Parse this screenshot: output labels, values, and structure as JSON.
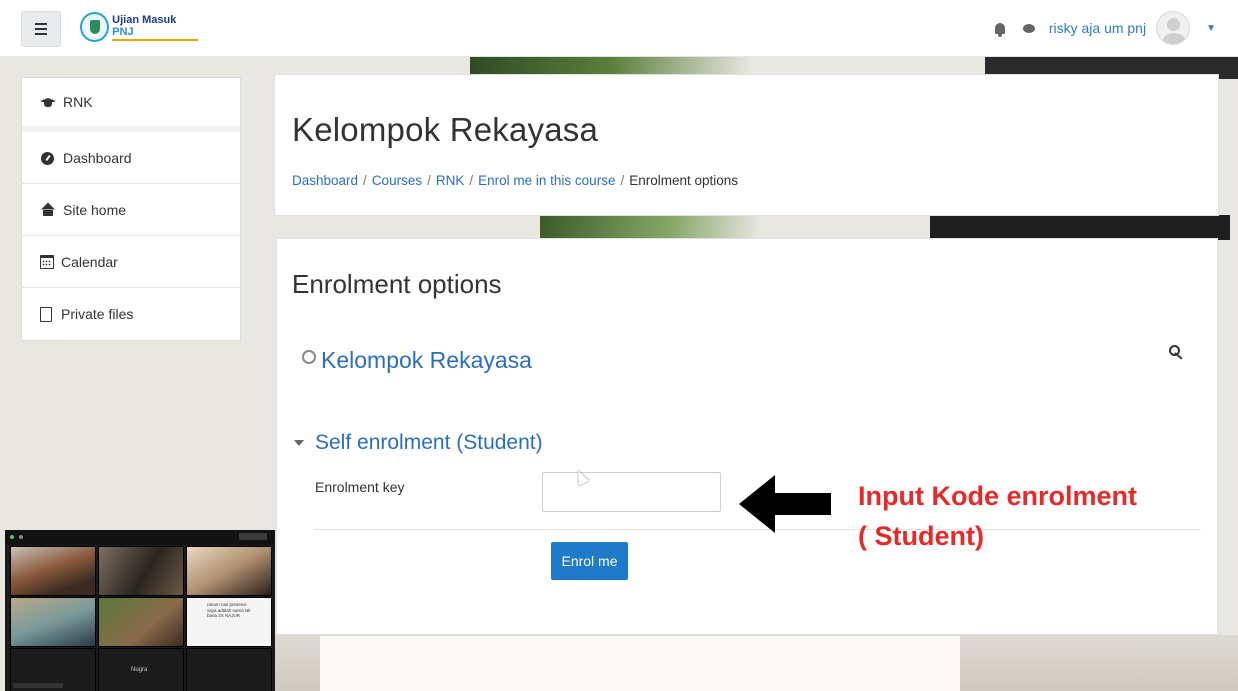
{
  "header": {
    "logo_text_main": "Ujian Masuk",
    "logo_text_brand": "PNJ",
    "username": "risky aja um pnj"
  },
  "sidebar": {
    "items": [
      {
        "label": "RNK",
        "icon": "graduation-cap-icon"
      },
      {
        "label": "Dashboard",
        "icon": "dashboard-icon"
      },
      {
        "label": "Site home",
        "icon": "home-icon"
      },
      {
        "label": "Calendar",
        "icon": "calendar-icon"
      },
      {
        "label": "Private files",
        "icon": "file-icon"
      }
    ]
  },
  "page": {
    "title": "Kelompok Rekayasa",
    "breadcrumb": [
      "Dashboard",
      "Courses",
      "RNK",
      "Enrol me in this course",
      "Enrolment options"
    ]
  },
  "main": {
    "section_title": "Enrolment options",
    "course_name": "Kelompok Rekayasa",
    "enrol_heading": "Self enrolment (Student)",
    "key_label": "Enrolment key",
    "key_value": "",
    "enrol_button": "Enrol me"
  },
  "annotation": {
    "text": "Input Kode enrolment\n( Student)",
    "color": "#e62a2a"
  },
  "video_call": {
    "participant_name": "Nugra",
    "shared_text": "ranum nas presensi saya adalah nama Nk bana 2X NAJUR"
  },
  "colors": {
    "link": "#2c6ebc",
    "button": "#1f7ac9",
    "annotation": "#e62a2a"
  }
}
